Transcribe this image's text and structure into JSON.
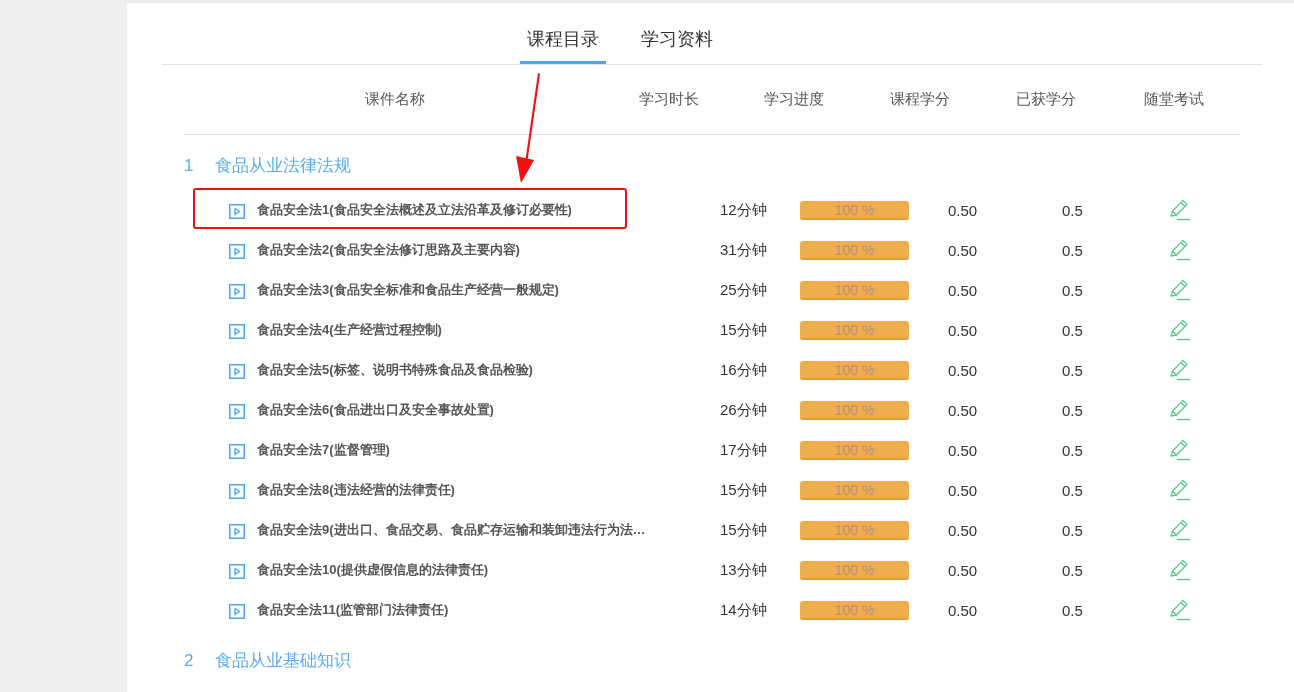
{
  "tabs": [
    {
      "label": "课程目录",
      "selected": true
    },
    {
      "label": "学习资料",
      "selected": false
    }
  ],
  "columns": [
    "课件名称",
    "学习时长",
    "学习进度",
    "课程学分",
    "已获学分",
    "随堂考试"
  ],
  "sections": [
    {
      "number": "1",
      "title": "食品从业法律法规",
      "lessons": [
        {
          "title": "食品安全法1(食品安全法概述及立法沿革及修订必要性)",
          "duration": "12分钟",
          "level": 1,
          "progress_label": "100 %",
          "credit": "0.50",
          "earned": "0.5",
          "highlighted": true
        },
        {
          "title": "食品安全法2(食品安全法修订思路及主要内容)",
          "duration": "31分钟",
          "level": 1,
          "progress_label": "100 %",
          "credit": "0.50",
          "earned": "0.5",
          "highlighted": false
        },
        {
          "title": "食品安全法3(食品安全标准和食品生产经营一般规定)",
          "duration": "25分钟",
          "level": 1,
          "progress_label": "100 %",
          "credit": "0.50",
          "earned": "0.5",
          "highlighted": false
        },
        {
          "title": "食品安全法4(生产经营过程控制)",
          "duration": "15分钟",
          "level": 1,
          "progress_label": "100 %",
          "credit": "0.50",
          "earned": "0.5",
          "highlighted": false
        },
        {
          "title": "食品安全法5(标签、说明书特殊食品及食品检验)",
          "duration": "16分钟",
          "level": 1,
          "progress_label": "100 %",
          "credit": "0.50",
          "earned": "0.5",
          "highlighted": false
        },
        {
          "title": "食品安全法6(食品进出口及安全事故处置)",
          "duration": "26分钟",
          "level": 1,
          "progress_label": "100 %",
          "credit": "0.50",
          "earned": "0.5",
          "highlighted": false
        },
        {
          "title": "食品安全法7(监督管理)",
          "duration": "17分钟",
          "level": 1,
          "progress_label": "100 %",
          "credit": "0.50",
          "earned": "0.5",
          "highlighted": false
        },
        {
          "title": "食品安全法8(违法经营的法律责任)",
          "duration": "15分钟",
          "level": 1,
          "progress_label": "100 %",
          "credit": "0.50",
          "earned": "0.5",
          "highlighted": false
        },
        {
          "title": "食品安全法9(进出口、食品交易、食品贮存运输和装卸违法行为法…",
          "duration": "15分钟",
          "level": 1,
          "progress_label": "100 %",
          "credit": "0.50",
          "earned": "0.5",
          "highlighted": false
        },
        {
          "title": "食品安全法10(提供虚假信息的法律责任)",
          "duration": "13分钟",
          "level": 1,
          "progress_label": "100 %",
          "credit": "0.50",
          "earned": "0.5",
          "highlighted": false
        },
        {
          "title": "食品安全法11(监管部门法律责任)",
          "duration": "14分钟",
          "level": 1,
          "progress_label": "100 %",
          "credit": "0.50",
          "earned": "0.5",
          "highlighted": false
        }
      ]
    },
    {
      "number": "2",
      "title": "食品从业基础知识"
    }
  ]
}
